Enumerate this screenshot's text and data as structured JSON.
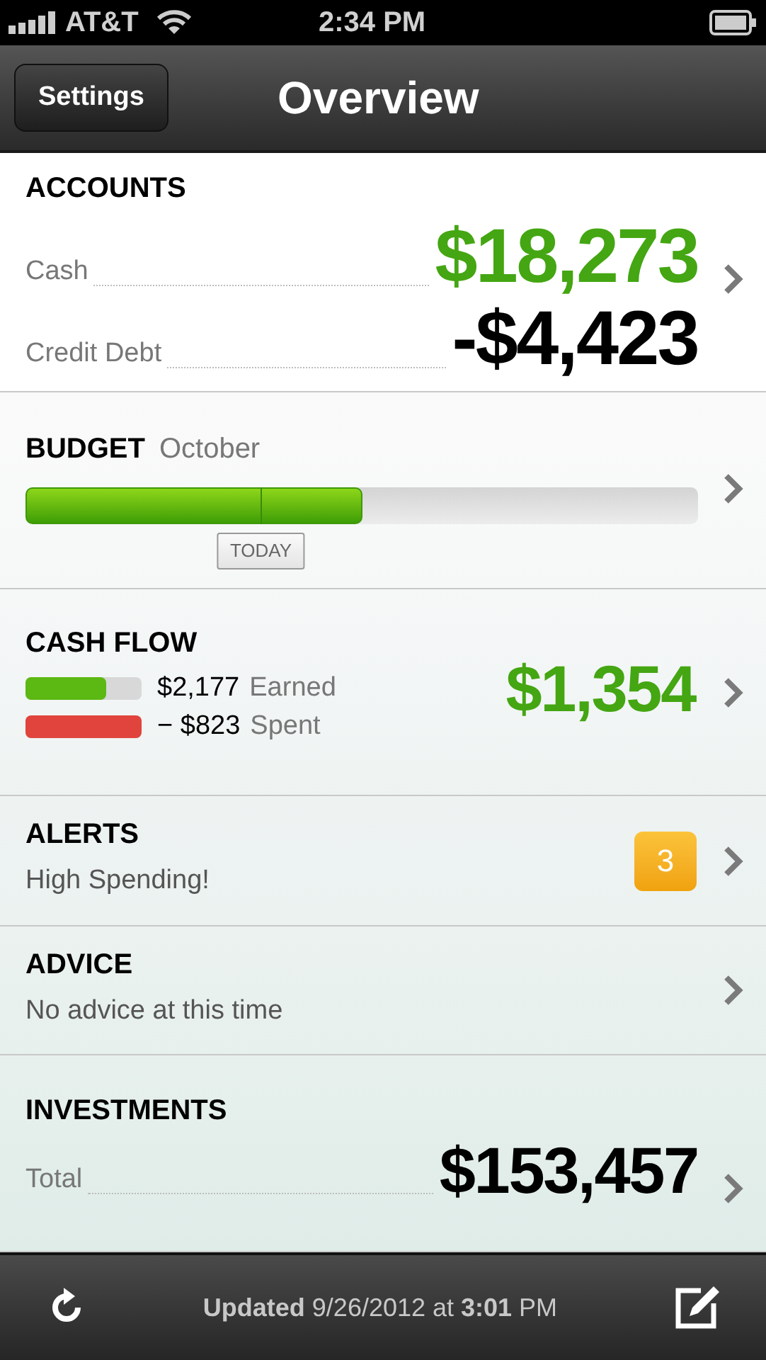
{
  "status_bar": {
    "carrier": "AT&T",
    "time": "2:34 PM"
  },
  "nav_bar": {
    "back_button": "Settings",
    "title": "Overview"
  },
  "accounts": {
    "title": "ACCOUNTS",
    "rows": [
      {
        "label": "Cash",
        "amount": "$18,273",
        "color": "#44a612"
      },
      {
        "label": "Credit Debt",
        "amount": "-$4,423",
        "color": "#000000"
      }
    ]
  },
  "budget": {
    "title": "BUDGET",
    "month": "October",
    "level": 0.5,
    "today_marker": {
      "label": "TODAY",
      "level": 0.35
    }
  },
  "cash_flow": {
    "title": "CASH FLOW",
    "total": "$1,354",
    "rows": [
      {
        "amount": "$2,177",
        "label": "Earned",
        "level": 0.69,
        "color": "#5cb812"
      },
      {
        "amount": "− $823",
        "label": "Spent",
        "level": 1,
        "color": "#e0443c"
      }
    ]
  },
  "alerts": {
    "title": "ALERTS",
    "subtitle": "High Spending!",
    "badge": "3"
  },
  "advice": {
    "title": "ADVICE",
    "subtitle": "No advice at this time"
  },
  "investments": {
    "title": "INVESTMENTS",
    "label": "Total",
    "amount": "$153,457"
  },
  "toolbar": {
    "status": "**Updated** 9/26/2012 at **3:01** PM"
  }
}
